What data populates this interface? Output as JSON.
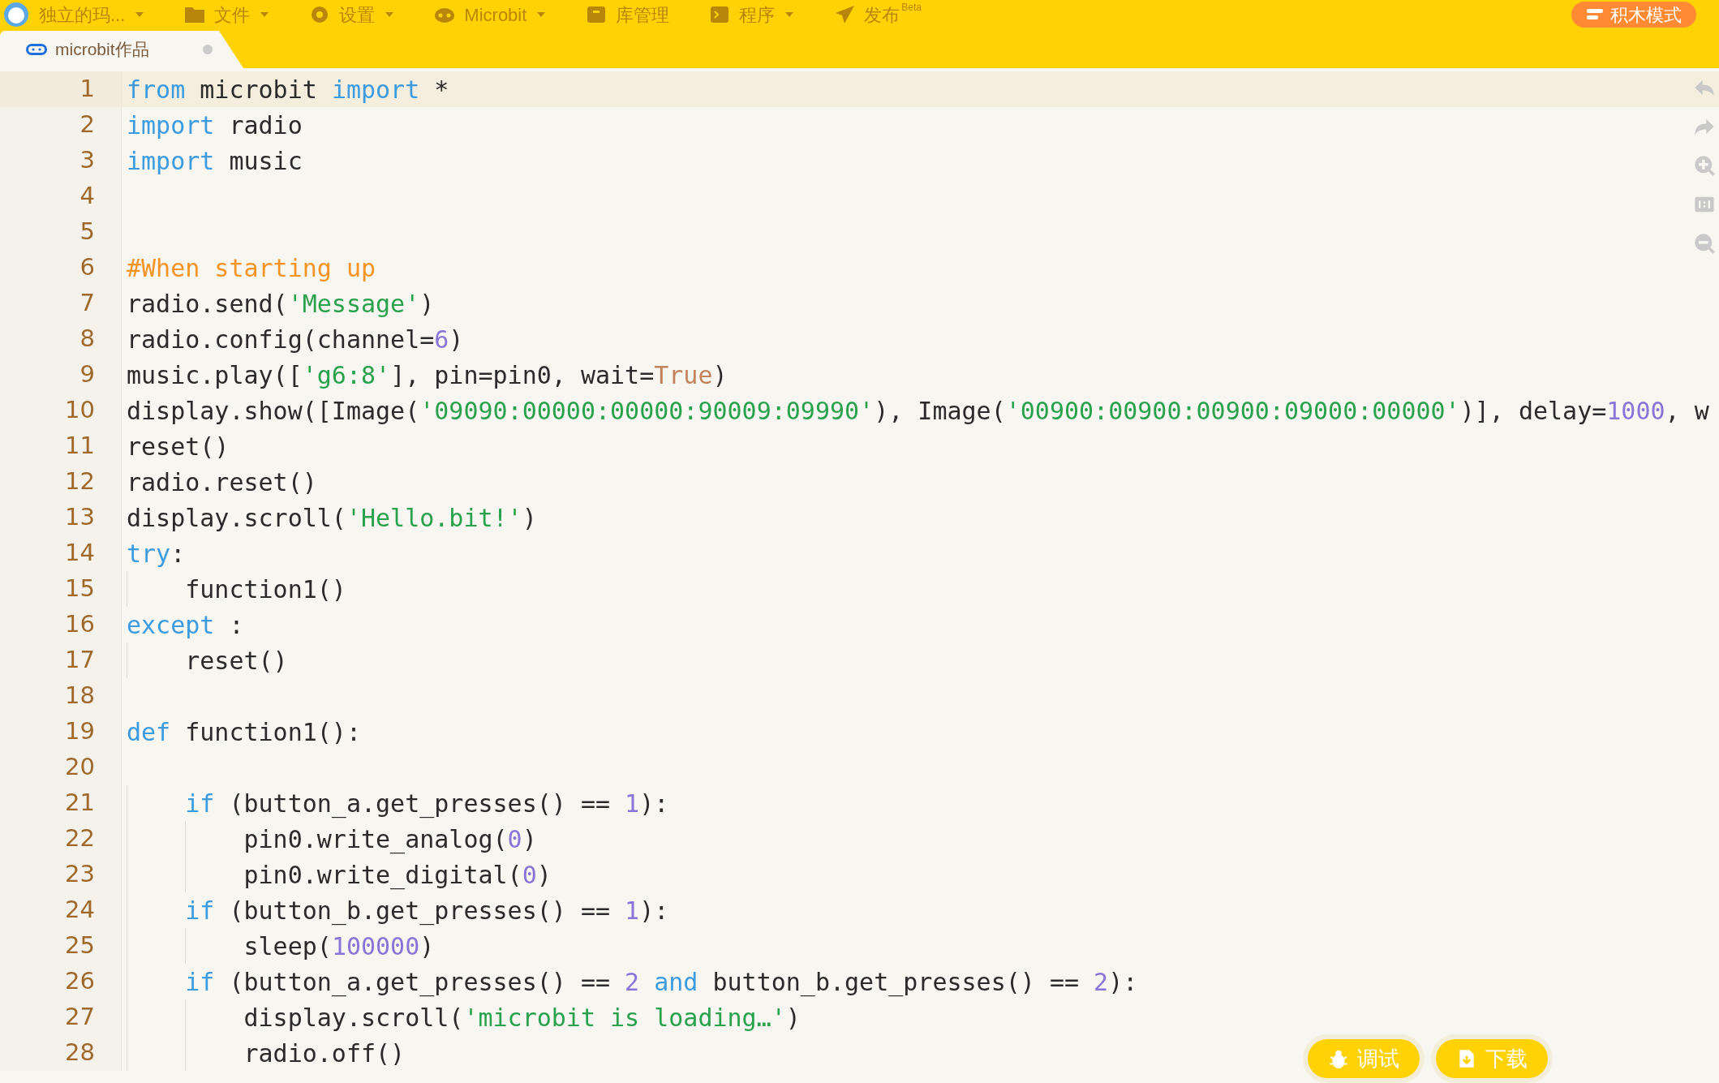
{
  "menu_bar": {
    "user": {
      "name": "独立的玛..."
    },
    "items": [
      {
        "label": "文件",
        "caret": true
      },
      {
        "label": "设置",
        "caret": true
      },
      {
        "label": "Microbit",
        "caret": true
      },
      {
        "label": "库管理",
        "caret": false
      },
      {
        "label": "程序",
        "caret": true
      },
      {
        "label": "发布",
        "caret": false,
        "badge": "Beta"
      }
    ],
    "mode_button": "积木模式"
  },
  "tabs": [
    {
      "label": "microbit作品",
      "selected": true,
      "unsaved": true
    }
  ],
  "editor": {
    "lines": [
      {
        "number": "1",
        "current": true,
        "tokens": [
          {
            "kind": "kw",
            "text": "from"
          },
          {
            "kind": "plain",
            "text": " microbit "
          },
          {
            "kind": "kw",
            "text": "import"
          },
          {
            "kind": "plain",
            "text": " *"
          }
        ]
      },
      {
        "number": "2",
        "current": false,
        "tokens": [
          {
            "kind": "kw",
            "text": "import"
          },
          {
            "kind": "plain",
            "text": " radio"
          }
        ]
      },
      {
        "number": "3",
        "current": false,
        "tokens": [
          {
            "kind": "kw",
            "text": "import"
          },
          {
            "kind": "plain",
            "text": " music"
          }
        ]
      },
      {
        "number": "4",
        "current": false
      },
      {
        "number": "5",
        "current": false
      },
      {
        "number": "6",
        "current": false,
        "tokens": [
          {
            "kind": "cmt",
            "text": "#When starting up"
          }
        ]
      },
      {
        "number": "7",
        "current": false,
        "tokens": [
          {
            "kind": "plain",
            "text": "radio.send("
          },
          {
            "kind": "str",
            "text": "'Message'"
          },
          {
            "kind": "plain",
            "text": ")"
          }
        ]
      },
      {
        "number": "8",
        "current": false,
        "tokens": [
          {
            "kind": "plain",
            "text": "radio.config(channel="
          },
          {
            "kind": "num",
            "text": "6"
          },
          {
            "kind": "plain",
            "text": ")"
          }
        ]
      },
      {
        "number": "9",
        "current": false,
        "tokens": [
          {
            "kind": "plain",
            "text": "music.play(["
          },
          {
            "kind": "str",
            "text": "'g6:8'"
          },
          {
            "kind": "plain",
            "text": "], pin=pin0, wait="
          },
          {
            "kind": "const",
            "text": "True"
          },
          {
            "kind": "plain",
            "text": ")"
          }
        ]
      },
      {
        "number": "10",
        "current": false,
        "tokens": [
          {
            "kind": "plain",
            "text": "display.show([Image("
          },
          {
            "kind": "str",
            "text": "'09090:00000:00000:90009:09990'"
          },
          {
            "kind": "plain",
            "text": "), Image("
          },
          {
            "kind": "str",
            "text": "'00900:00900:00900:09000:00000'"
          },
          {
            "kind": "plain",
            "text": ")], delay="
          },
          {
            "kind": "num",
            "text": "1000"
          },
          {
            "kind": "plain",
            "text": ", w"
          }
        ]
      },
      {
        "number": "11",
        "current": false,
        "tokens": [
          {
            "kind": "plain",
            "text": "reset()"
          }
        ]
      },
      {
        "number": "12",
        "current": false,
        "tokens": [
          {
            "kind": "plain",
            "text": "radio.reset()"
          }
        ]
      },
      {
        "number": "13",
        "current": false,
        "tokens": [
          {
            "kind": "plain",
            "text": "display.scroll("
          },
          {
            "kind": "str",
            "text": "'Hello.bit!'"
          },
          {
            "kind": "plain",
            "text": ")"
          }
        ]
      },
      {
        "number": "14",
        "current": false,
        "tokens": [
          {
            "kind": "kw",
            "text": "try"
          },
          {
            "kind": "plain",
            "text": ":"
          }
        ]
      },
      {
        "number": "15",
        "current": false,
        "tokens": [
          {
            "kind": "plain",
            "text": "    function1()"
          }
        ]
      },
      {
        "number": "16",
        "current": false,
        "tokens": [
          {
            "kind": "kw",
            "text": "except"
          },
          {
            "kind": "plain",
            "text": " :"
          }
        ]
      },
      {
        "number": "17",
        "current": false,
        "tokens": [
          {
            "kind": "plain",
            "text": "    reset()"
          }
        ]
      },
      {
        "number": "18",
        "current": false
      },
      {
        "number": "19",
        "current": false,
        "tokens": [
          {
            "kind": "kw",
            "text": "def"
          },
          {
            "kind": "plain",
            "text": " function1():"
          }
        ]
      },
      {
        "number": "20",
        "current": false
      },
      {
        "number": "21",
        "current": false,
        "tokens": [
          {
            "kind": "kw",
            "text": "    if"
          },
          {
            "kind": "plain",
            "text": " (button_a.get_presses() == "
          },
          {
            "kind": "num",
            "text": "1"
          },
          {
            "kind": "plain",
            "text": "):"
          }
        ]
      },
      {
        "number": "22",
        "current": false,
        "tokens": [
          {
            "kind": "plain",
            "text": "        pin0.write_analog("
          },
          {
            "kind": "num",
            "text": "0"
          },
          {
            "kind": "plain",
            "text": ")"
          }
        ]
      },
      {
        "number": "23",
        "current": false,
        "tokens": [
          {
            "kind": "plain",
            "text": "        pin0.write_digital("
          },
          {
            "kind": "num",
            "text": "0"
          },
          {
            "kind": "plain",
            "text": ")"
          }
        ]
      },
      {
        "number": "24",
        "current": false,
        "tokens": [
          {
            "kind": "kw",
            "text": "    if"
          },
          {
            "kind": "plain",
            "text": " (button_b.get_presses() == "
          },
          {
            "kind": "num",
            "text": "1"
          },
          {
            "kind": "plain",
            "text": "):"
          }
        ]
      },
      {
        "number": "25",
        "current": false,
        "tokens": [
          {
            "kind": "plain",
            "text": "        sleep("
          },
          {
            "kind": "num",
            "text": "100000"
          },
          {
            "kind": "plain",
            "text": ")"
          }
        ]
      },
      {
        "number": "26",
        "current": false,
        "tokens": [
          {
            "kind": "kw",
            "text": "    if"
          },
          {
            "kind": "plain",
            "text": " (button_a.get_presses() == "
          },
          {
            "kind": "num",
            "text": "2"
          },
          {
            "kind": "kw",
            "text": " and"
          },
          {
            "kind": "plain",
            "text": " button_b.get_presses() == "
          },
          {
            "kind": "num",
            "text": "2"
          },
          {
            "kind": "plain",
            "text": "):"
          }
        ]
      },
      {
        "number": "27",
        "current": false,
        "tokens": [
          {
            "kind": "plain",
            "text": "        display.scroll("
          },
          {
            "kind": "str",
            "text": "'microbit is loading…'"
          },
          {
            "kind": "plain",
            "text": ")"
          }
        ]
      },
      {
        "number": "28",
        "current": false,
        "tokens": [
          {
            "kind": "plain",
            "text": "        radio.off()"
          }
        ]
      }
    ]
  },
  "actions": [
    {
      "label": "调试"
    },
    {
      "label": "下载"
    }
  ]
}
